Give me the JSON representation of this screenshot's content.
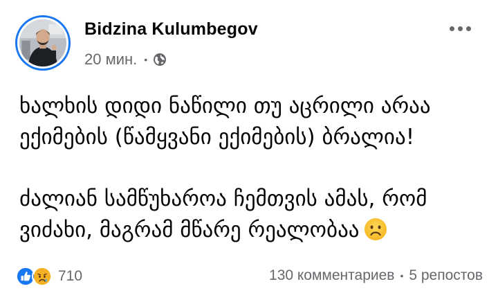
{
  "post": {
    "author": "Bidzina Kulumbegov",
    "time": "20 мин.",
    "separator": "•",
    "privacy_icon": "globe-icon",
    "menu_icon": "more-horizontal-icon",
    "text_line_1": "ხალხის დიდი ნაწილი თუ აცრილი არაა",
    "text_line_2": "ექიმების (წამყვანი ექიმების)  ბრალია!",
    "text_line_3": "ძალიან სამწუხაროა ჩემთვის ამას, რომ",
    "text_line_4": "ვიძახი, მაგრამ მწარე რეალობაა",
    "emoji": "sad-face-emoji"
  },
  "footer": {
    "reaction_icons": [
      "like-icon",
      "sad-reaction-icon"
    ],
    "reaction_count": "710",
    "comments": "130 комментариев",
    "separator": "•",
    "shares": "5 репостов"
  },
  "colors": {
    "accent": "#1877f2",
    "text": "#050505",
    "secondary_text": "#65676b",
    "background": "#ffffff"
  }
}
